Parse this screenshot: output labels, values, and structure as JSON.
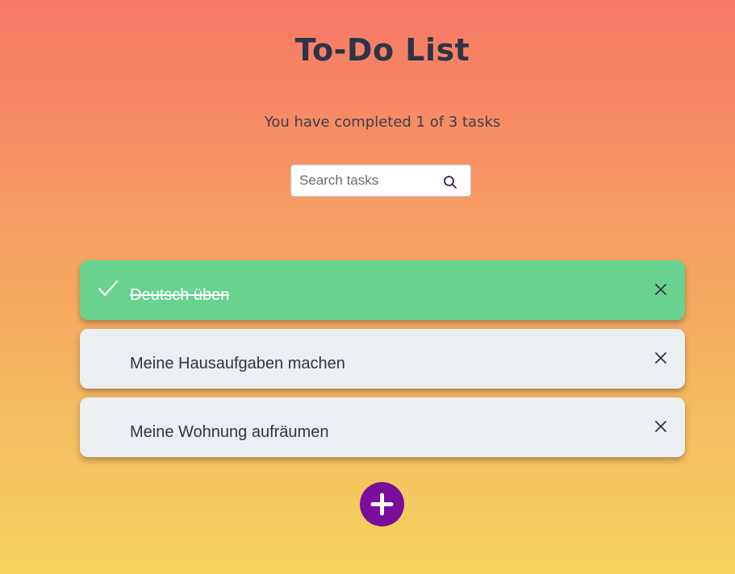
{
  "header": {
    "title": "To-Do List",
    "subtitle": "You have completed 1 of 3 tasks"
  },
  "search": {
    "placeholder": "Search tasks",
    "value": "",
    "icon": "search-icon"
  },
  "tasks": [
    {
      "label": "Deutsch üben",
      "completed": true,
      "icons": [
        "check-icon",
        "close-icon"
      ]
    },
    {
      "label": "Meine Hausaufgaben machen",
      "completed": false,
      "icons": [
        "close-icon"
      ]
    },
    {
      "label": "Meine Wohnung aufräumen",
      "completed": false,
      "icons": [
        "close-icon"
      ]
    }
  ],
  "add_button": {
    "icon": "plus-icon"
  },
  "colors": {
    "background_top": "#f77866",
    "background_bottom": "#f5d55e",
    "completed_task": "#68d28e",
    "open_task": "#ebeff4",
    "add_button": "#7a0e9a",
    "text": "#2d3447"
  }
}
